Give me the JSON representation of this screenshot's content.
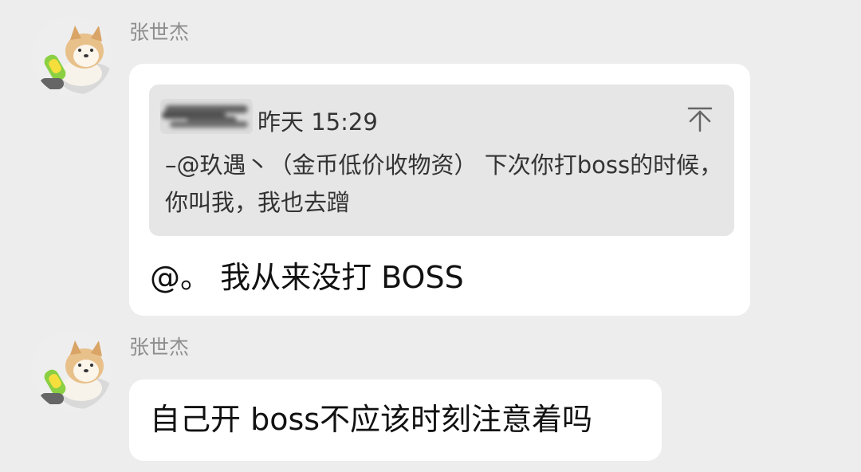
{
  "messages": [
    {
      "sender": "张世杰",
      "quote": {
        "time": "昨天 15:29",
        "text": "–@玖遇丶（金币低价收物资） 下次你打boss的时候，你叫我，我也去蹭"
      },
      "text": "@。 我从来没打 BOSS"
    },
    {
      "sender": "张世杰",
      "text": "自己开 boss不应该时刻注意着吗"
    }
  ],
  "icons": {
    "avatar": "dog-with-corn-toy-icon",
    "pin": "pin-to-top-icon"
  },
  "colors": {
    "background": "#ededed",
    "bubble": "#ffffff",
    "quote_background": "#e6e6e6",
    "sender_name": "#8d8d8d"
  }
}
